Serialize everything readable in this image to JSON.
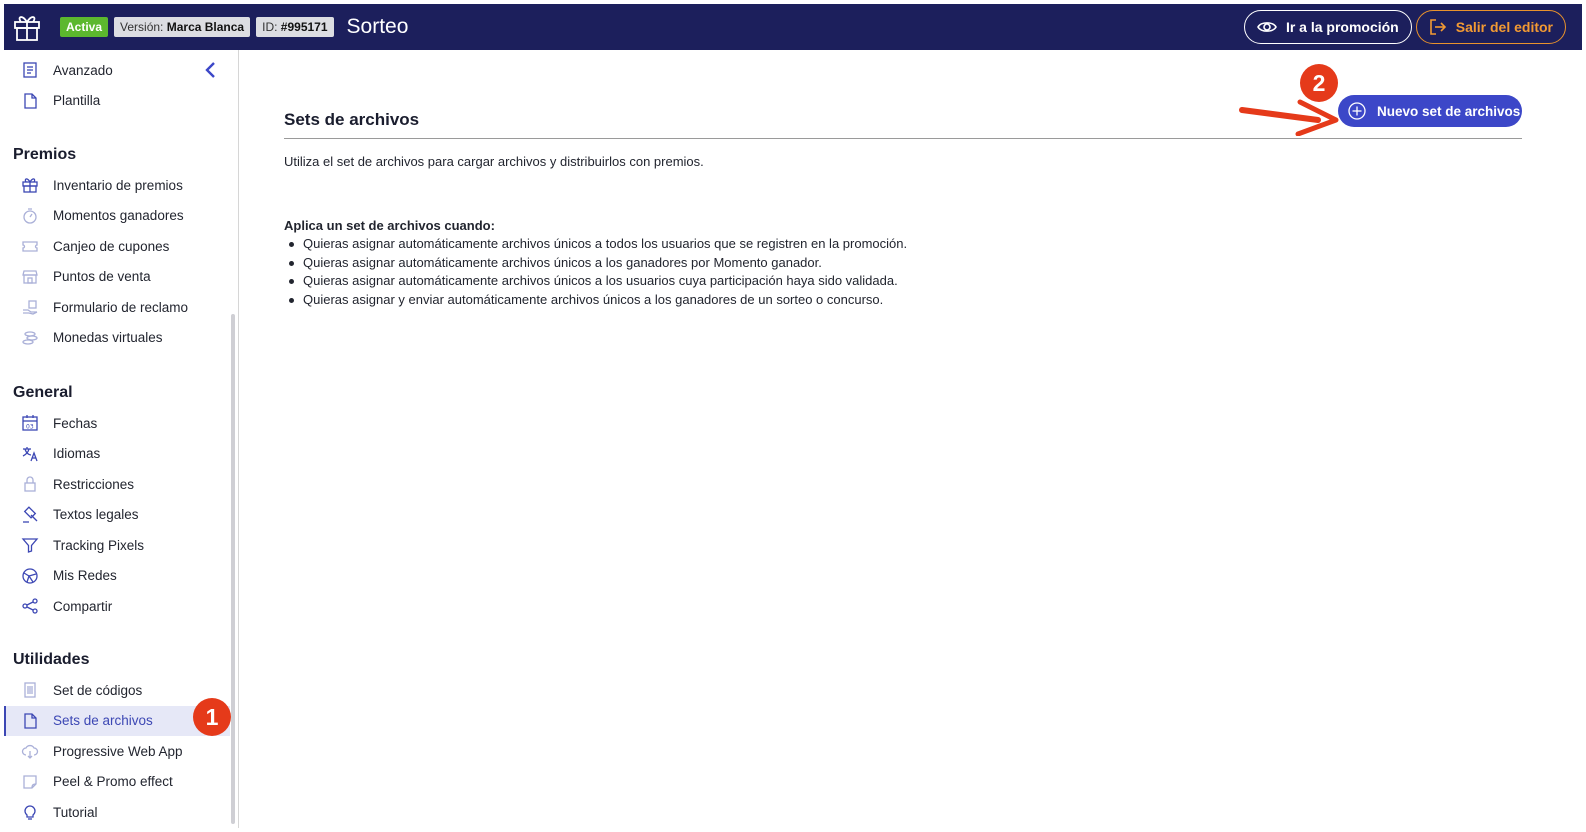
{
  "header": {
    "status_badge": "Activa",
    "version_label": "Versión:",
    "version_value": "Marca Blanca",
    "id_label": "ID:",
    "id_value": "#995171",
    "title": "Sorteo",
    "go_to_promo_label": "Ir a la promoción",
    "exit_editor_label": "Salir del editor"
  },
  "sidebar": {
    "top_items": [
      {
        "label": "Avanzado",
        "icon": "list-doc-icon"
      },
      {
        "label": "Plantilla",
        "icon": "document-icon"
      }
    ],
    "sections": [
      {
        "title": "Premios",
        "items": [
          {
            "label": "Inventario de premios",
            "icon": "gift-icon"
          },
          {
            "label": "Momentos ganadores",
            "icon": "stopwatch-icon"
          },
          {
            "label": "Canjeo de cupones",
            "icon": "coupon-icon"
          },
          {
            "label": "Puntos de venta",
            "icon": "store-icon"
          },
          {
            "label": "Formulario de reclamo",
            "icon": "hand-form-icon"
          },
          {
            "label": "Monedas virtuales",
            "icon": "coins-icon"
          }
        ]
      },
      {
        "title": "General",
        "items": [
          {
            "label": "Fechas",
            "icon": "calendar-icon"
          },
          {
            "label": "Idiomas",
            "icon": "translate-icon"
          },
          {
            "label": "Restricciones",
            "icon": "lock-icon"
          },
          {
            "label": "Textos legales",
            "icon": "gavel-icon"
          },
          {
            "label": "Tracking Pixels",
            "icon": "funnel-icon"
          },
          {
            "label": "Mis Redes",
            "icon": "globe-network-icon"
          },
          {
            "label": "Compartir",
            "icon": "share-icon"
          }
        ]
      },
      {
        "title": "Utilidades",
        "items": [
          {
            "label": "Set de códigos",
            "icon": "code-set-icon"
          },
          {
            "label": "Sets de archivos",
            "icon": "document-icon",
            "selected": true
          },
          {
            "label": "Progressive Web App",
            "icon": "cloud-download-icon"
          },
          {
            "label": "Peel & Promo effect",
            "icon": "peel-icon"
          },
          {
            "label": "Tutorial",
            "icon": "lightbulb-icon"
          }
        ]
      }
    ]
  },
  "main": {
    "title": "Sets de archivos",
    "new_button_label": "Nuevo set de archivos",
    "description": "Utiliza el set de archivos para cargar archivos y distribuirlos con premios.",
    "apply_title": "Aplica un set de archivos cuando:",
    "apply_items": [
      "Quieras asignar automáticamente archivos únicos a todos los usuarios que se registren en la promoción.",
      "Quieras asignar automáticamente archivos únicos a los ganadores por Momento ganador.",
      "Quieras asignar automáticamente archivos únicos a los usuarios cuya participación haya sido validada.",
      "Quieras asignar y enviar automáticamente archivos únicos a los ganadores de un sorteo o concurso."
    ]
  },
  "annotations": {
    "marker_1": "1",
    "marker_2": "2",
    "marker_color": "#e53a1a"
  },
  "colors": {
    "topbar": "#1c1f5c",
    "accent": "#3c47c8",
    "active_badge": "#5cb82e",
    "exit_orange": "#f29a33"
  }
}
